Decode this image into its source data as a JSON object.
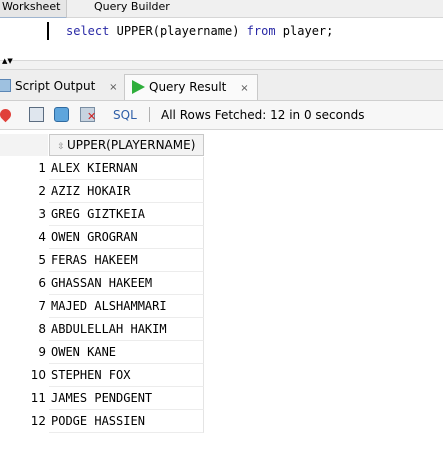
{
  "editor_tabs": [
    "Worksheet",
    "Query Builder"
  ],
  "editor": {
    "kw_select": "select",
    "expression": "UPPER(playername)",
    "kw_from": "from",
    "table": "player;"
  },
  "panel_tabs": {
    "script_output": "Script Output",
    "query_result": "Query Result",
    "close_glyph": "×"
  },
  "toolbar": {
    "sql_label": "SQL",
    "status": "All Rows Fetched: 12 in 0 seconds",
    "icons": [
      "pin-icon",
      "print-icon",
      "refresh-icon",
      "delete-icon"
    ]
  },
  "grid": {
    "column": "UPPER(PLAYERNAME)",
    "rows": [
      {
        "num": "1",
        "value": "ALEX KIERNAN"
      },
      {
        "num": "2",
        "value": "AZIZ HOKAIR"
      },
      {
        "num": "3",
        "value": "GREG GIZTKEIA"
      },
      {
        "num": "4",
        "value": "OWEN GROGRAN"
      },
      {
        "num": "5",
        "value": "FERAS HAKEEM"
      },
      {
        "num": "6",
        "value": "GHASSAN HAKEEM"
      },
      {
        "num": "7",
        "value": "MAJED ALSHAMMARI"
      },
      {
        "num": "8",
        "value": "ABDULELLAH HAKIM"
      },
      {
        "num": "9",
        "value": "OWEN KANE"
      },
      {
        "num": "10",
        "value": "STEPHEN FOX"
      },
      {
        "num": "11",
        "value": "JAMES PENDGENT"
      },
      {
        "num": "12",
        "value": "PODGE HASSIEN"
      }
    ]
  }
}
